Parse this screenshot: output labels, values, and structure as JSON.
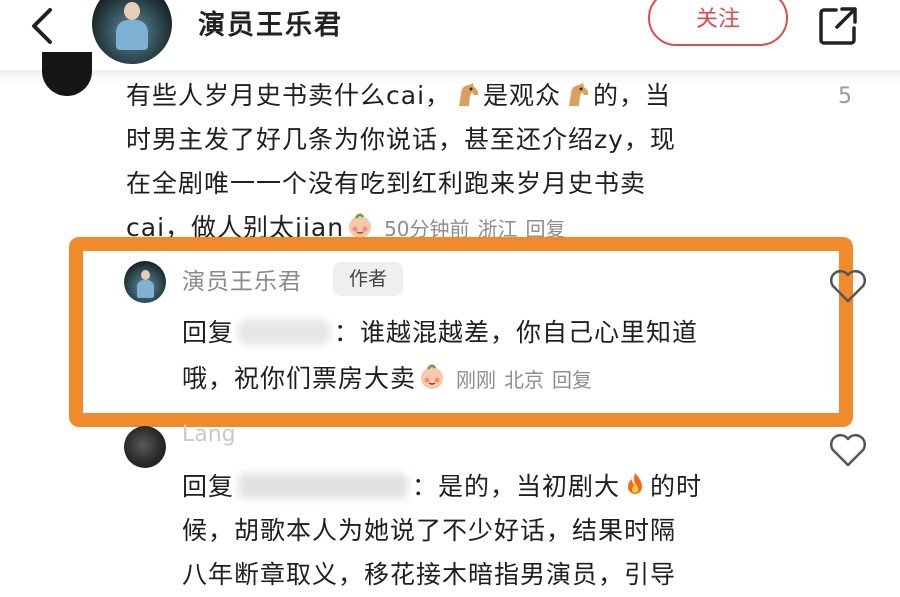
{
  "header": {
    "title": "演员王乐君",
    "follow_label": "关注"
  },
  "comment1": {
    "lines": [
      [
        "有些人岁月史书卖什么cai，",
        "是观众",
        "的，当"
      ],
      "时男主发了好几条为你说话，甚至还介绍zy，现",
      "在全剧唯一一个没有吃到红利跑来岁月史书卖",
      "cai，做人别太jian"
    ],
    "time": "50分钟前",
    "location": "浙江",
    "reply_label": "回复",
    "like_count": "5"
  },
  "author_reply": {
    "name": "演员王乐君",
    "badge": "作者",
    "prefix": "回复",
    "line1_rest": "：谁越混越差，你自己心里知道",
    "line2": "哦，祝你们票房大卖",
    "time": "刚刚",
    "location": "北京",
    "reply_label": "回复"
  },
  "comment3": {
    "name": "Lang",
    "prefix": "回复",
    "line1_rest": "：是的，当初剧大",
    "line1_end": "的时",
    "line2": "候，胡歌本人为她说了不少好话，结果时隔",
    "line3": "八年断章取义，移花接木暗指男演员，引导"
  },
  "icons": {
    "back": "chevron-left-icon",
    "share": "share-external-icon",
    "like": "heart-outline-icon",
    "horse": "horse-emoji-icon",
    "shy": "shy-face-emoji-icon",
    "fire": "fire-emoji-icon"
  },
  "colors": {
    "highlight": "#f08a2b",
    "follow": "#e04b4b"
  }
}
